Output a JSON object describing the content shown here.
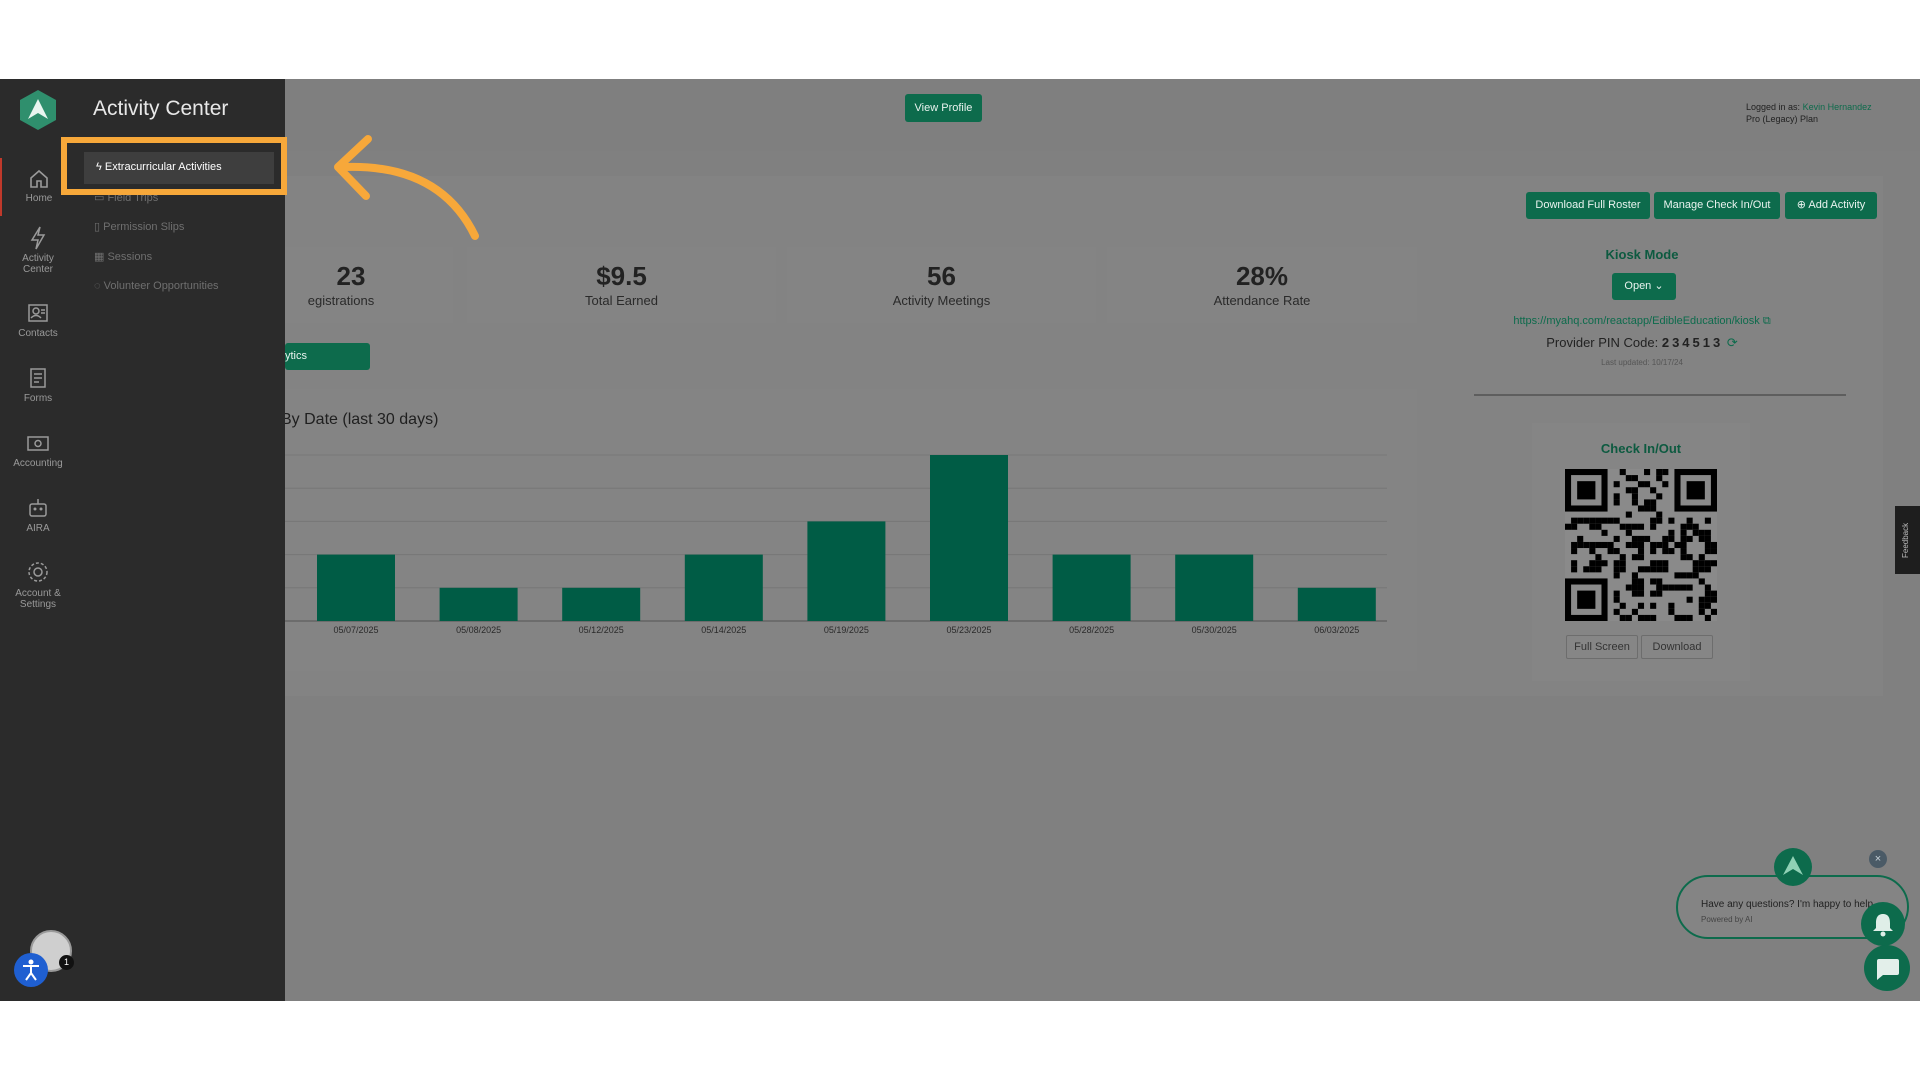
{
  "sidebar": {
    "items": [
      {
        "label": "Home",
        "icon": "home-icon"
      },
      {
        "label": "Activity Center",
        "icon": "lightning-icon"
      },
      {
        "label": "Contacts",
        "icon": "contacts-icon"
      },
      {
        "label": "Forms",
        "icon": "forms-icon"
      },
      {
        "label": "Accounting",
        "icon": "accounting-icon"
      },
      {
        "label": "AIRA",
        "icon": "robot-icon"
      },
      {
        "label": "Account & Settings",
        "icon": "gear-icon"
      }
    ],
    "notification_count": "1"
  },
  "flyout": {
    "title": "Activity Center",
    "items": [
      {
        "label": "Extracurricular Activities",
        "icon": "lightning-icon"
      },
      {
        "label": "Field Trips",
        "icon": "bus-icon"
      },
      {
        "label": "Permission Slips",
        "icon": "document-icon"
      },
      {
        "label": "Sessions",
        "icon": "calendar-icon"
      },
      {
        "label": "Volunteer Opportunities",
        "icon": "volunteer-icon"
      }
    ]
  },
  "header": {
    "view_profile_label": "View Profile",
    "logged_in_prefix": "Logged in as:",
    "user_name": "Kevin Hernandez",
    "plan": "Pro (Legacy) Plan"
  },
  "toolbar": {
    "download_roster_label": "Download Full Roster",
    "manage_checkin_label": "Manage Check In/Out",
    "add_activity_label": "Add Activity"
  },
  "stats": [
    {
      "value": "23",
      "label": "Registrations"
    },
    {
      "value": "$9.5",
      "label": "Total Earned"
    },
    {
      "value": "56",
      "label": "Activity Meetings"
    },
    {
      "value": "28%",
      "label": "Attendance Rate"
    }
  ],
  "analytics_button_label": "ytics",
  "chart_data": {
    "type": "bar",
    "title": "By Date (last 30 days)",
    "categories": [
      "05/07/2025",
      "05/08/2025",
      "05/12/2025",
      "05/14/2025",
      "05/19/2025",
      "05/23/2025",
      "05/28/2025",
      "05/30/2025",
      "06/03/2025"
    ],
    "values": [
      2,
      1,
      1,
      2,
      3,
      5,
      2,
      2,
      1
    ],
    "ylim": [
      0,
      5
    ],
    "grid": true,
    "bar_color": "#005c45"
  },
  "kiosk": {
    "title": "Kiosk Mode",
    "open_label": "Open",
    "url": "https://myahq.com/reactapp/EdibleEducation/kiosk",
    "pin_label": "Provider PIN Code:",
    "pin_value": "234513",
    "last_updated": "Last updated: 10/17/24"
  },
  "checkin": {
    "title": "Check In/Out",
    "full_screen_label": "Full Screen",
    "download_label": "Download"
  },
  "feedback_label": "Feedback",
  "chat": {
    "message": "Have any questions? I'm happy to help.",
    "powered_by": "Powered by AI",
    "close_label": "×"
  },
  "colors": {
    "brand_green": "#0d6b4c",
    "highlight_orange": "#f7a83a",
    "sidebar_bg": "#2b2b2b"
  }
}
